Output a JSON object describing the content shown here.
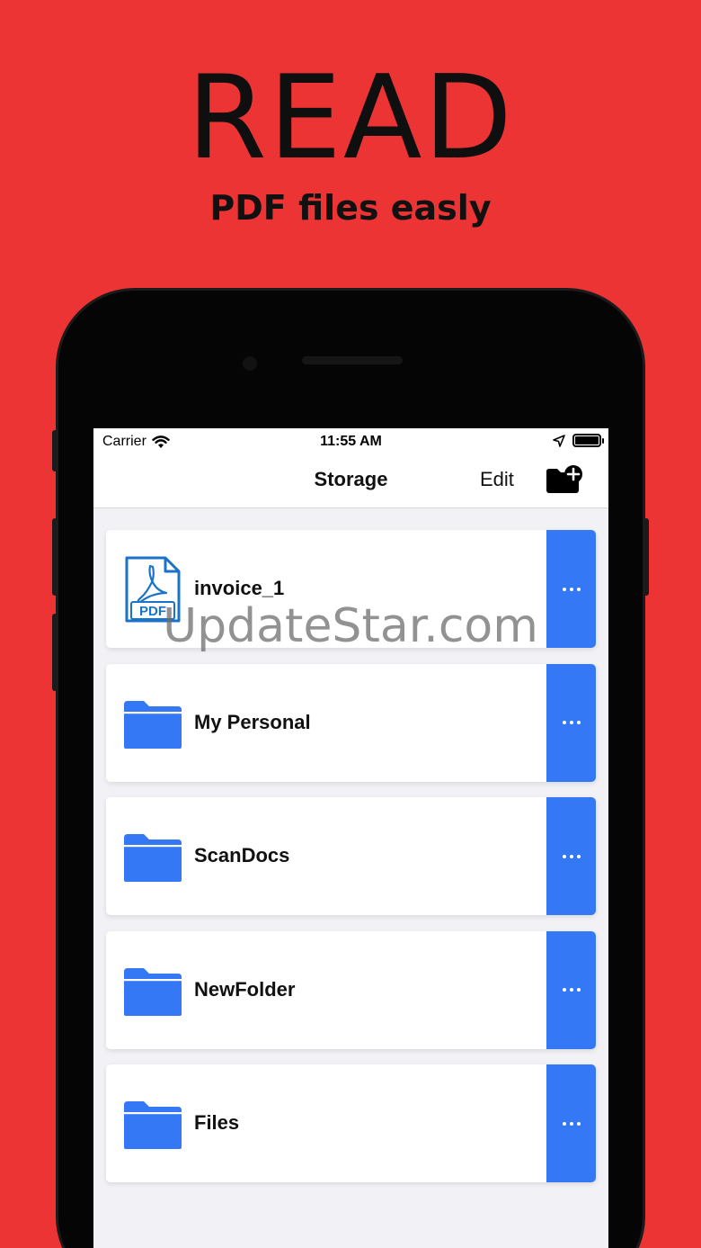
{
  "promo": {
    "headline": "READ",
    "subline": "PDF files easly"
  },
  "status_bar": {
    "carrier": "Carrier",
    "time": "11:55 AM",
    "icons": [
      "wifi-icon",
      "location-arrow-icon",
      "battery-icon"
    ]
  },
  "nav": {
    "title": "Storage",
    "edit_label": "Edit",
    "new_folder_icon": "folder-plus-icon"
  },
  "items": [
    {
      "label": "invoice_1",
      "icon": "pdf-file-icon",
      "more_icon": "more-dots-icon"
    },
    {
      "label": "My Personal",
      "icon": "folder-icon",
      "more_icon": "more-dots-icon"
    },
    {
      "label": "ScanDocs",
      "icon": "folder-icon",
      "more_icon": "more-dots-icon"
    },
    {
      "label": "NewFolder",
      "icon": "folder-icon",
      "more_icon": "more-dots-icon"
    },
    {
      "label": "Files",
      "icon": "folder-icon",
      "more_icon": "more-dots-icon"
    }
  ],
  "pdf_icon_text": "PDF",
  "watermark": "UpdateStar.com",
  "colors": {
    "background": "#ec3434",
    "accent": "#3478f6",
    "pdf_blue": "#1a73c8"
  }
}
